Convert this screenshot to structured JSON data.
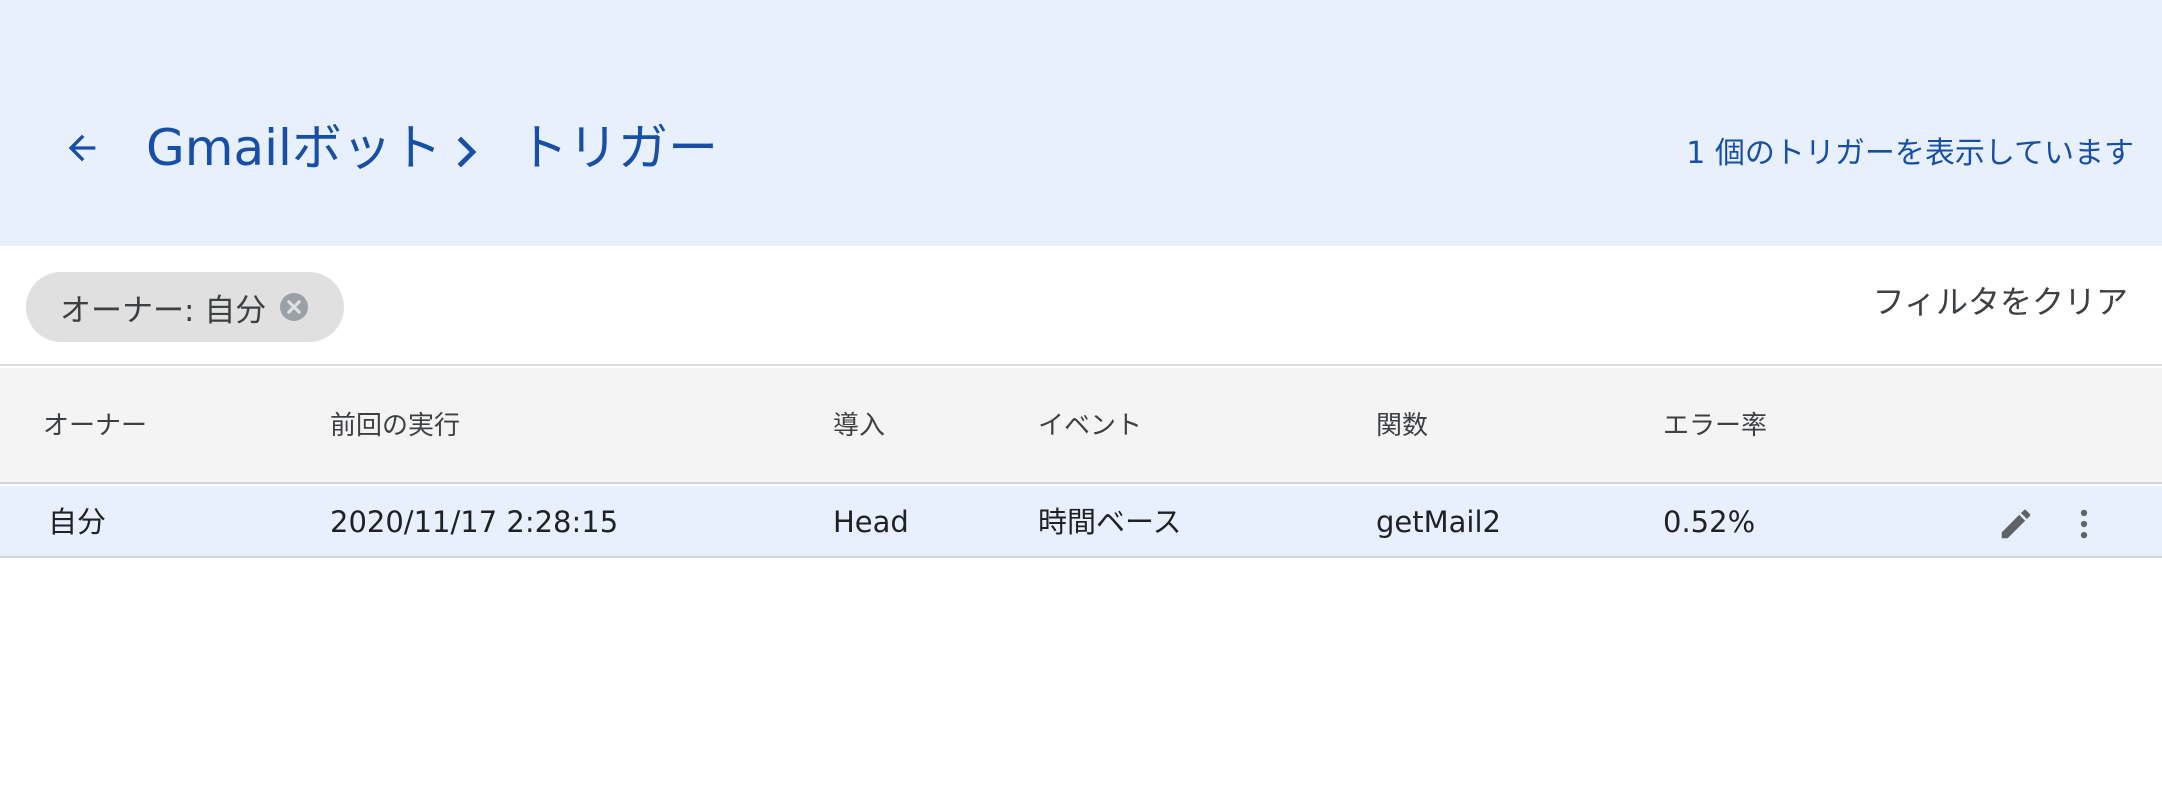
{
  "header": {
    "back_icon": "arrow-left-icon",
    "project_name": "Gmailボット",
    "separator_icon": "chevron-right-icon",
    "current_page": "トリガー",
    "count_text": "1 個のトリガーを表示しています"
  },
  "filters": {
    "chip_label": "オーナー: 自分",
    "chip_close_icon": "close-circle-icon",
    "clear_label": "フィルタをクリア"
  },
  "table": {
    "columns": [
      "オーナー",
      "前回の実行",
      "導入",
      "イベント",
      "関数",
      "エラー率"
    ],
    "rows": [
      {
        "owner": "自分",
        "last_run": "2020/11/17 2:28:15",
        "deployment": "Head",
        "event": "時間ベース",
        "function": "getMail2",
        "error_rate": "0.52%",
        "edit_icon": "pencil-icon",
        "more_icon": "more-vert-icon"
      }
    ]
  },
  "colors": {
    "header_bg": "#e8f0fe",
    "accent": "#174ea6",
    "row_bg": "#e8f0fe",
    "table_head_bg": "#f4f4f4",
    "chip_bg": "#e0e0e0"
  }
}
